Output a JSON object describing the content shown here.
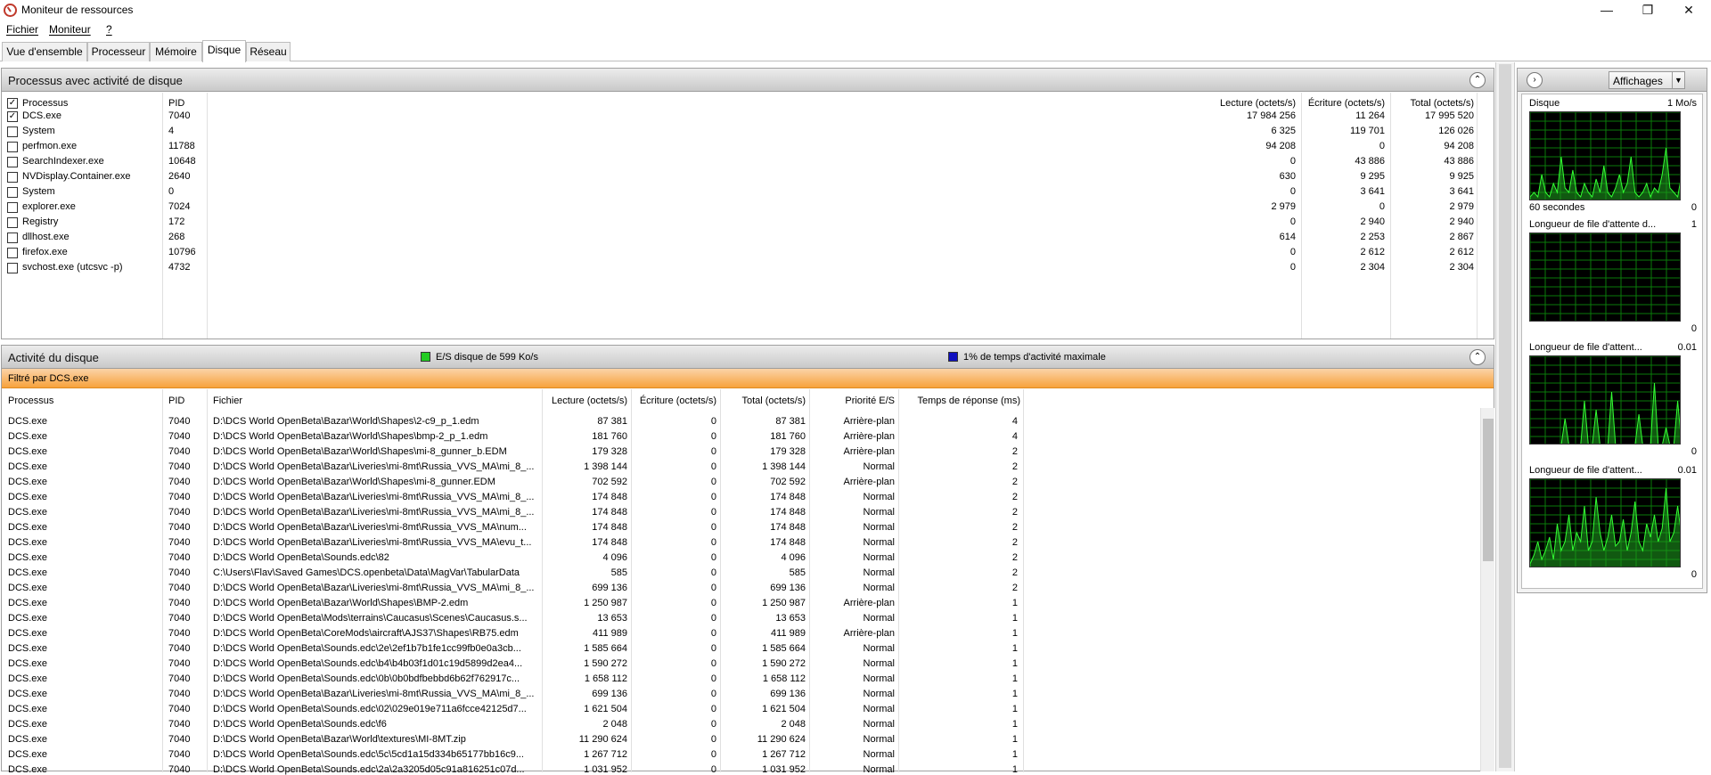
{
  "window": {
    "title": "Moniteur de ressources"
  },
  "menu": [
    "Fichier",
    "Moniteur",
    "?"
  ],
  "tabs": [
    "Vue d'ensemble",
    "Processeur",
    "Mémoire",
    "Disque",
    "Réseau"
  ],
  "active_tab": "Disque",
  "processes_panel": {
    "title": "Processus avec activité de disque",
    "headers": {
      "process": "Processus",
      "pid": "PID",
      "read": "Lecture (octets/s)",
      "write": "Écriture (octets/s)",
      "total": "Total (octets/s)"
    },
    "rows": [
      {
        "name": "DCS.exe",
        "pid": "7040",
        "read": "17 984 256",
        "write": "11 264",
        "total": "17 995 520",
        "checked": true
      },
      {
        "name": "System",
        "pid": "4",
        "read": "6 325",
        "write": "119 701",
        "total": "126 026",
        "checked": false
      },
      {
        "name": "perfmon.exe",
        "pid": "11788",
        "read": "94 208",
        "write": "0",
        "total": "94 208",
        "checked": false
      },
      {
        "name": "SearchIndexer.exe",
        "pid": "10648",
        "read": "0",
        "write": "43 886",
        "total": "43 886",
        "checked": false
      },
      {
        "name": "NVDisplay.Container.exe",
        "pid": "2640",
        "read": "630",
        "write": "9 295",
        "total": "9 925",
        "checked": false
      },
      {
        "name": "System",
        "pid": "0",
        "read": "0",
        "write": "3 641",
        "total": "3 641",
        "checked": false
      },
      {
        "name": "explorer.exe",
        "pid": "7024",
        "read": "2 979",
        "write": "0",
        "total": "2 979",
        "checked": false
      },
      {
        "name": "Registry",
        "pid": "172",
        "read": "0",
        "write": "2 940",
        "total": "2 940",
        "checked": false
      },
      {
        "name": "dllhost.exe",
        "pid": "268",
        "read": "614",
        "write": "2 253",
        "total": "2 867",
        "checked": false
      },
      {
        "name": "firefox.exe",
        "pid": "10796",
        "read": "0",
        "write": "2 612",
        "total": "2 612",
        "checked": false
      },
      {
        "name": "svchost.exe (utcsvc -p)",
        "pid": "4732",
        "read": "0",
        "write": "2 304",
        "total": "2 304",
        "checked": false
      }
    ]
  },
  "disk_panel": {
    "title": "Activité du disque",
    "io_legend": "E/S disque de 599 Ko/s",
    "active_legend": "1% de temps d'activité maximale",
    "io_color": "#22cc22",
    "active_color": "#1010c0",
    "filter": "Filtré par DCS.exe",
    "headers": {
      "process": "Processus",
      "pid": "PID",
      "file": "Fichier",
      "read": "Lecture (octets/s)",
      "write": "Écriture (octets/s)",
      "total": "Total (octets/s)",
      "priority": "Priorité E/S",
      "response": "Temps de réponse (ms)"
    },
    "rows": [
      {
        "proc": "DCS.exe",
        "pid": "7040",
        "file": "D:\\DCS World OpenBeta\\Bazar\\World\\Shapes\\2-c9_p_1.edm",
        "read": "87 381",
        "write": "0",
        "total": "87 381",
        "prio": "Arrière-plan",
        "resp": "4"
      },
      {
        "proc": "DCS.exe",
        "pid": "7040",
        "file": "D:\\DCS World OpenBeta\\Bazar\\World\\Shapes\\bmp-2_p_1.edm",
        "read": "181 760",
        "write": "0",
        "total": "181 760",
        "prio": "Arrière-plan",
        "resp": "4"
      },
      {
        "proc": "DCS.exe",
        "pid": "7040",
        "file": "D:\\DCS World OpenBeta\\Bazar\\World\\Shapes\\mi-8_gunner_b.EDM",
        "read": "179 328",
        "write": "0",
        "total": "179 328",
        "prio": "Arrière-plan",
        "resp": "2"
      },
      {
        "proc": "DCS.exe",
        "pid": "7040",
        "file": "D:\\DCS World OpenBeta\\Bazar\\Liveries\\mi-8mt\\Russia_VVS_MA\\mi_8_...",
        "read": "1 398 144",
        "write": "0",
        "total": "1 398 144",
        "prio": "Normal",
        "resp": "2"
      },
      {
        "proc": "DCS.exe",
        "pid": "7040",
        "file": "D:\\DCS World OpenBeta\\Bazar\\World\\Shapes\\mi-8_gunner.EDM",
        "read": "702 592",
        "write": "0",
        "total": "702 592",
        "prio": "Arrière-plan",
        "resp": "2"
      },
      {
        "proc": "DCS.exe",
        "pid": "7040",
        "file": "D:\\DCS World OpenBeta\\Bazar\\Liveries\\mi-8mt\\Russia_VVS_MA\\mi_8_...",
        "read": "174 848",
        "write": "0",
        "total": "174 848",
        "prio": "Normal",
        "resp": "2"
      },
      {
        "proc": "DCS.exe",
        "pid": "7040",
        "file": "D:\\DCS World OpenBeta\\Bazar\\Liveries\\mi-8mt\\Russia_VVS_MA\\mi_8_...",
        "read": "174 848",
        "write": "0",
        "total": "174 848",
        "prio": "Normal",
        "resp": "2"
      },
      {
        "proc": "DCS.exe",
        "pid": "7040",
        "file": "D:\\DCS World OpenBeta\\Bazar\\Liveries\\mi-8mt\\Russia_VVS_MA\\num...",
        "read": "174 848",
        "write": "0",
        "total": "174 848",
        "prio": "Normal",
        "resp": "2"
      },
      {
        "proc": "DCS.exe",
        "pid": "7040",
        "file": "D:\\DCS World OpenBeta\\Bazar\\Liveries\\mi-8mt\\Russia_VVS_MA\\evu_t...",
        "read": "174 848",
        "write": "0",
        "total": "174 848",
        "prio": "Normal",
        "resp": "2"
      },
      {
        "proc": "DCS.exe",
        "pid": "7040",
        "file": "D:\\DCS World OpenBeta\\Sounds.edc\\82",
        "read": "4 096",
        "write": "0",
        "total": "4 096",
        "prio": "Normal",
        "resp": "2"
      },
      {
        "proc": "DCS.exe",
        "pid": "7040",
        "file": "C:\\Users\\Flav\\Saved Games\\DCS.openbeta\\Data\\MagVar\\TabularData",
        "read": "585",
        "write": "0",
        "total": "585",
        "prio": "Normal",
        "resp": "2"
      },
      {
        "proc": "DCS.exe",
        "pid": "7040",
        "file": "D:\\DCS World OpenBeta\\Bazar\\Liveries\\mi-8mt\\Russia_VVS_MA\\mi_8_...",
        "read": "699 136",
        "write": "0",
        "total": "699 136",
        "prio": "Normal",
        "resp": "2"
      },
      {
        "proc": "DCS.exe",
        "pid": "7040",
        "file": "D:\\DCS World OpenBeta\\Bazar\\World\\Shapes\\BMP-2.edm",
        "read": "1 250 987",
        "write": "0",
        "total": "1 250 987",
        "prio": "Arrière-plan",
        "resp": "1"
      },
      {
        "proc": "DCS.exe",
        "pid": "7040",
        "file": "D:\\DCS World OpenBeta\\Mods\\terrains\\Caucasus\\Scenes\\Caucasus.s...",
        "read": "13 653",
        "write": "0",
        "total": "13 653",
        "prio": "Normal",
        "resp": "1"
      },
      {
        "proc": "DCS.exe",
        "pid": "7040",
        "file": "D:\\DCS World OpenBeta\\CoreMods\\aircraft\\AJS37\\Shapes\\RB75.edm",
        "read": "411 989",
        "write": "0",
        "total": "411 989",
        "prio": "Arrière-plan",
        "resp": "1"
      },
      {
        "proc": "DCS.exe",
        "pid": "7040",
        "file": "D:\\DCS World OpenBeta\\Sounds.edc\\2e\\2ef1b7b1fe1cc99fb0e0a3cb...",
        "read": "1 585 664",
        "write": "0",
        "total": "1 585 664",
        "prio": "Normal",
        "resp": "1"
      },
      {
        "proc": "DCS.exe",
        "pid": "7040",
        "file": "D:\\DCS World OpenBeta\\Sounds.edc\\b4\\b4b03f1d01c19d5899d2ea4...",
        "read": "1 590 272",
        "write": "0",
        "total": "1 590 272",
        "prio": "Normal",
        "resp": "1"
      },
      {
        "proc": "DCS.exe",
        "pid": "7040",
        "file": "D:\\DCS World OpenBeta\\Sounds.edc\\0b\\0b0bdfbebbd6b62f762917c...",
        "read": "1 658 112",
        "write": "0",
        "total": "1 658 112",
        "prio": "Normal",
        "resp": "1"
      },
      {
        "proc": "DCS.exe",
        "pid": "7040",
        "file": "D:\\DCS World OpenBeta\\Bazar\\Liveries\\mi-8mt\\Russia_VVS_MA\\mi_8_...",
        "read": "699 136",
        "write": "0",
        "total": "699 136",
        "prio": "Normal",
        "resp": "1"
      },
      {
        "proc": "DCS.exe",
        "pid": "7040",
        "file": "D:\\DCS World OpenBeta\\Sounds.edc\\02\\029e019e711a6fcce42125d7...",
        "read": "1 621 504",
        "write": "0",
        "total": "1 621 504",
        "prio": "Normal",
        "resp": "1"
      },
      {
        "proc": "DCS.exe",
        "pid": "7040",
        "file": "D:\\DCS World OpenBeta\\Sounds.edc\\f6",
        "read": "2 048",
        "write": "0",
        "total": "2 048",
        "prio": "Normal",
        "resp": "1"
      },
      {
        "proc": "DCS.exe",
        "pid": "7040",
        "file": "D:\\DCS World OpenBeta\\Bazar\\World\\textures\\MI-8MT.zip",
        "read": "11 290 624",
        "write": "0",
        "total": "11 290 624",
        "prio": "Normal",
        "resp": "1"
      },
      {
        "proc": "DCS.exe",
        "pid": "7040",
        "file": "D:\\DCS World OpenBeta\\Sounds.edc\\5c\\5cd1a15d334b65177bb16c9...",
        "read": "1 267 712",
        "write": "0",
        "total": "1 267 712",
        "prio": "Normal",
        "resp": "1"
      },
      {
        "proc": "DCS.exe",
        "pid": "7040",
        "file": "D:\\DCS World OpenBeta\\Sounds.edc\\2a\\2a3205d05c91a816251c07d...",
        "read": "1 031 952",
        "write": "0",
        "total": "1 031 952",
        "prio": "Normal",
        "resp": "1"
      }
    ]
  },
  "side": {
    "view_button": "Affichages",
    "graphs": [
      {
        "title": "Disque",
        "scale": "1 Mo/s",
        "footer_left": "60 secondes",
        "footer_right": "0",
        "values": [
          0.05,
          0.1,
          0.05,
          0.3,
          0.1,
          0.05,
          0.2,
          0.1,
          0.5,
          0.15,
          0.1,
          0.35,
          0.1,
          0.05,
          0.2,
          0.1,
          0.05,
          0.25,
          0.1,
          0.4,
          0.1,
          0.05,
          0.15,
          0.3,
          0.1,
          0.2,
          0.5,
          0.1,
          0.05,
          0.1,
          0.2,
          0.05,
          0.15,
          0.1,
          0.3,
          0.6,
          0.15,
          0.1,
          0.05,
          0.3
        ]
      },
      {
        "title": "Longueur de file d'attente d...",
        "scale": "1",
        "footer_right": "0",
        "values": []
      },
      {
        "title": "Longueur de file d'attent...",
        "scale": "0.01",
        "footer_right": "0",
        "values": [
          0,
          0,
          0,
          0,
          0,
          0,
          0,
          0,
          0,
          0.3,
          0,
          0,
          0,
          0,
          0.5,
          0,
          0,
          0.4,
          0,
          0,
          0,
          0.6,
          0,
          0,
          0,
          0,
          0,
          0,
          0.35,
          0,
          0,
          0,
          0.7,
          0,
          0,
          0.2,
          0,
          0,
          0.5,
          0
        ]
      },
      {
        "title": "Longueur de file d'attent...",
        "scale": "0.01",
        "footer_right": "0",
        "values": [
          0.05,
          0.15,
          0.3,
          0.1,
          0.2,
          0.35,
          0.1,
          0.5,
          0.2,
          0.3,
          0.6,
          0.2,
          0.4,
          0.3,
          0.7,
          0.2,
          0.3,
          0.8,
          0.4,
          0.2,
          0.35,
          0.6,
          0.25,
          0.3,
          0.55,
          0.2,
          0.4,
          0.75,
          0.3,
          0.2,
          0.5,
          0.35,
          0.6,
          0.3,
          0.45,
          0.9,
          0.3,
          0.4,
          0.7,
          0.35
        ]
      }
    ]
  }
}
